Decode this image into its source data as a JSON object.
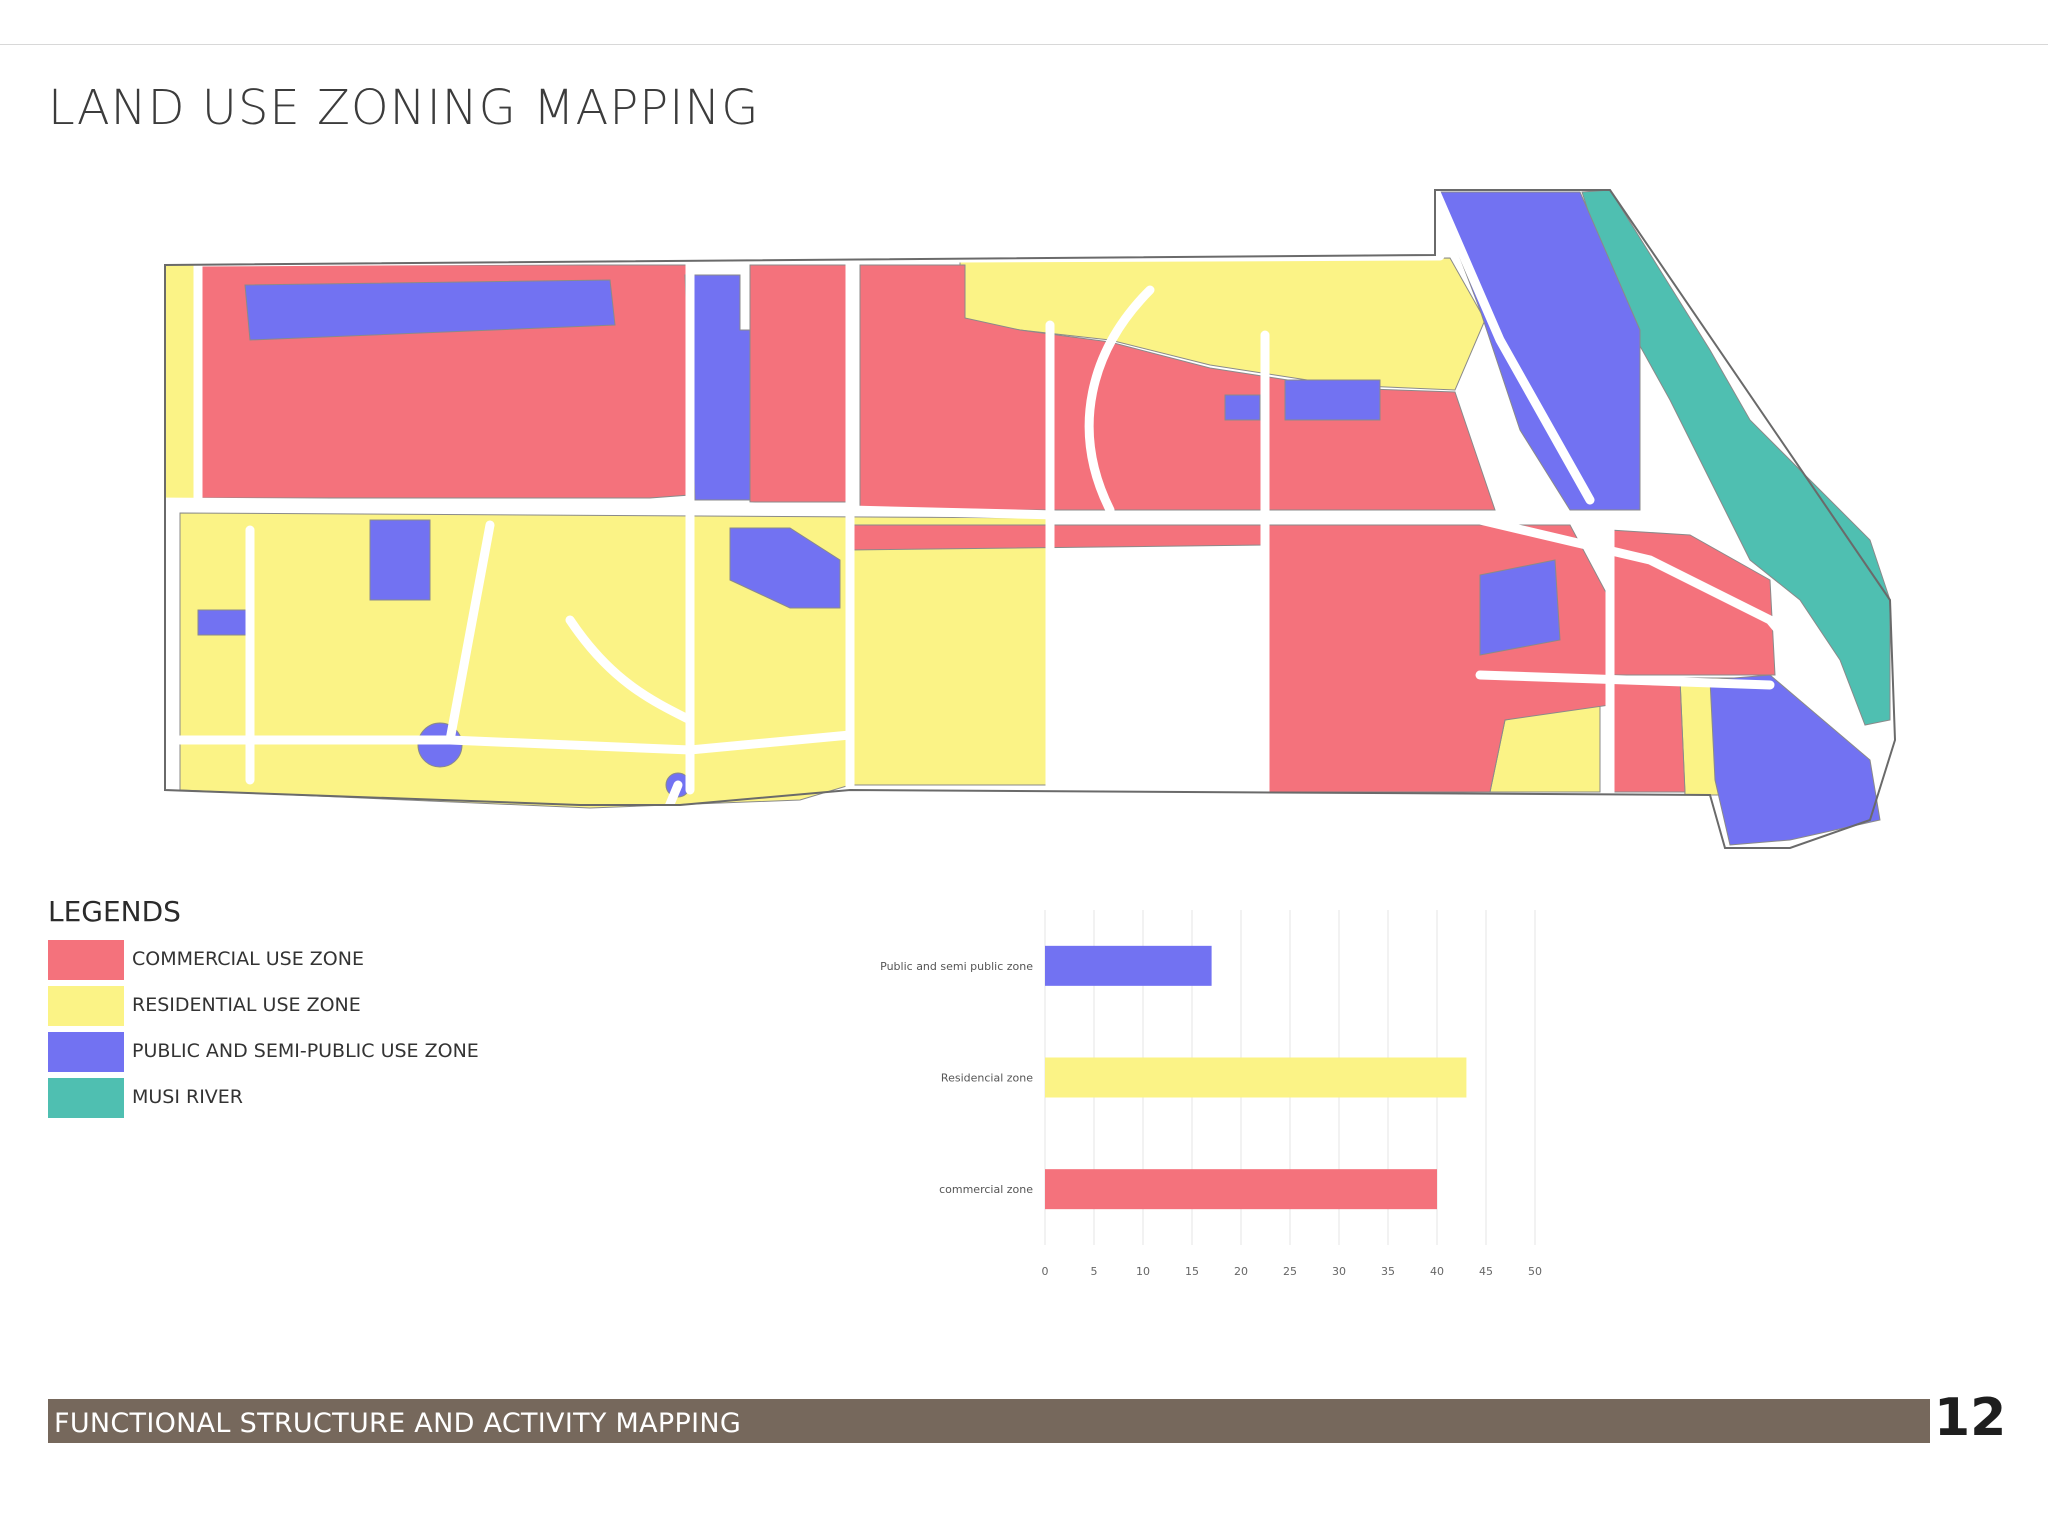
{
  "page": {
    "title": "LAND USE ZONING MAPPING",
    "footer": "FUNCTIONAL STRUCTURE AND ACTIVITY MAPPING",
    "page_number": "12"
  },
  "colors": {
    "commercial": "#f4727c",
    "residential": "#fbf386",
    "public": "#7272f2",
    "river": "#4fbfb1",
    "road": "#ffffff",
    "outline": "#6a6a6a",
    "footer_band": "#76685c"
  },
  "legend": {
    "title": "LEGENDS",
    "items": [
      {
        "label": "COMMERCIAL USE ZONE",
        "color": "#f4727c"
      },
      {
        "label": "RESIDENTIAL USE ZONE",
        "color": "#fbf386"
      },
      {
        "label": "PUBLIC AND SEMI-PUBLIC USE ZONE",
        "color": "#7272f2"
      },
      {
        "label": "MUSI RIVER",
        "color": "#4fbfb1"
      }
    ]
  },
  "chart_data": {
    "type": "bar",
    "orientation": "horizontal",
    "categories": [
      "Public and semi public zone",
      "Residencial zone",
      "commercial zone"
    ],
    "values": [
      17,
      43,
      40
    ],
    "colors": [
      "#7272f2",
      "#fbf386",
      "#f4727c"
    ],
    "xlim": [
      0,
      50
    ],
    "xticks": [
      0,
      5,
      10,
      15,
      20,
      25,
      30,
      35,
      40,
      45,
      50
    ],
    "grid": true,
    "legend": "none"
  }
}
